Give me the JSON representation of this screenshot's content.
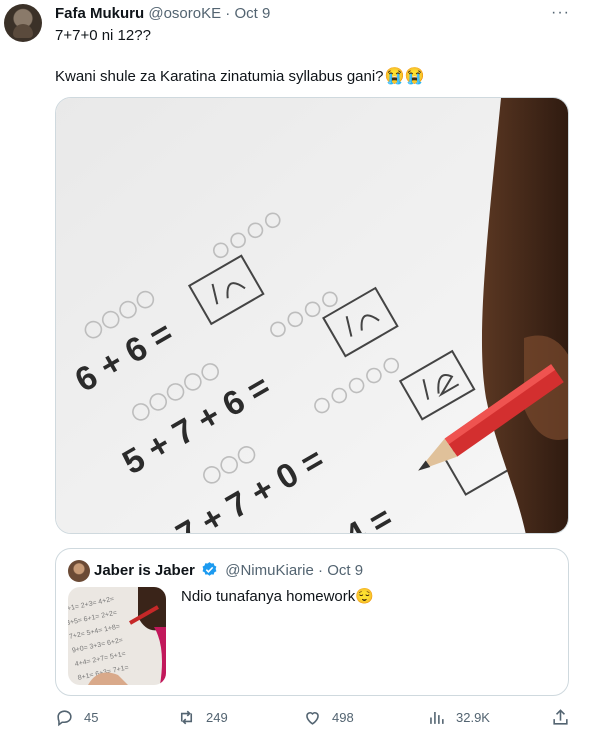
{
  "tweet": {
    "author_name": "Fafa Mukuru",
    "author_handle": "@osoroKE",
    "date": "Oct 9",
    "separator": "·",
    "more_label": "···",
    "line1": "7+7+0 ni 12??",
    "line2": "Kwani shule za Karatina zinatumia syllabus gani?",
    "line2_emoji": "😭😭"
  },
  "quote": {
    "author_name": "Jaber is Jaber",
    "author_handle": "@NimuKiarie",
    "date": "Oct 9",
    "separator": "·",
    "text": "Ndio tunafanya homework",
    "emoji": "😌"
  },
  "actions": {
    "replies": "45",
    "retweets": "249",
    "likes": "498",
    "views": "32.9K"
  },
  "icons": [
    "avatar",
    "more-icon",
    "reply-icon",
    "retweet-icon",
    "like-icon",
    "views-icon",
    "share-icon",
    "verified-icon"
  ],
  "colors": {
    "text": "#0f1419",
    "muted": "#536471",
    "border": "#cfd9de",
    "verified": "#1d9bf0"
  }
}
